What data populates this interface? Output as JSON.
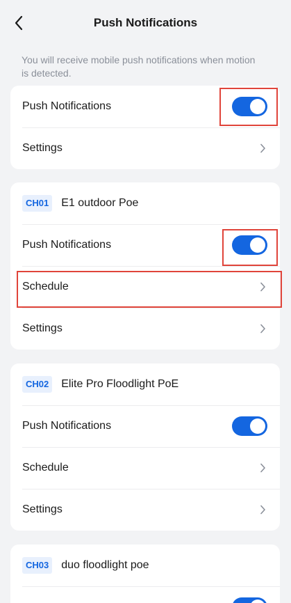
{
  "header": {
    "title": "Push Notifications"
  },
  "description": "You will receive mobile push notifications when motion is detected.",
  "global": {
    "push_label": "Push Notifications",
    "push_on": true,
    "settings_label": "Settings"
  },
  "channels": [
    {
      "badge": "CH01",
      "name": "E1 outdoor Poe",
      "push_label": "Push Notifications",
      "push_on": true,
      "schedule_label": "Schedule",
      "settings_label": "Settings"
    },
    {
      "badge": "CH02",
      "name": "Elite Pro Floodlight PoE",
      "push_label": "Push Notifications",
      "push_on": true,
      "schedule_label": "Schedule",
      "settings_label": "Settings"
    },
    {
      "badge": "CH03",
      "name": "duo floodlight poe",
      "push_on": true
    }
  ],
  "colors": {
    "accent": "#1466e0",
    "highlight": "#e0443a",
    "background": "#f2f3f5"
  }
}
